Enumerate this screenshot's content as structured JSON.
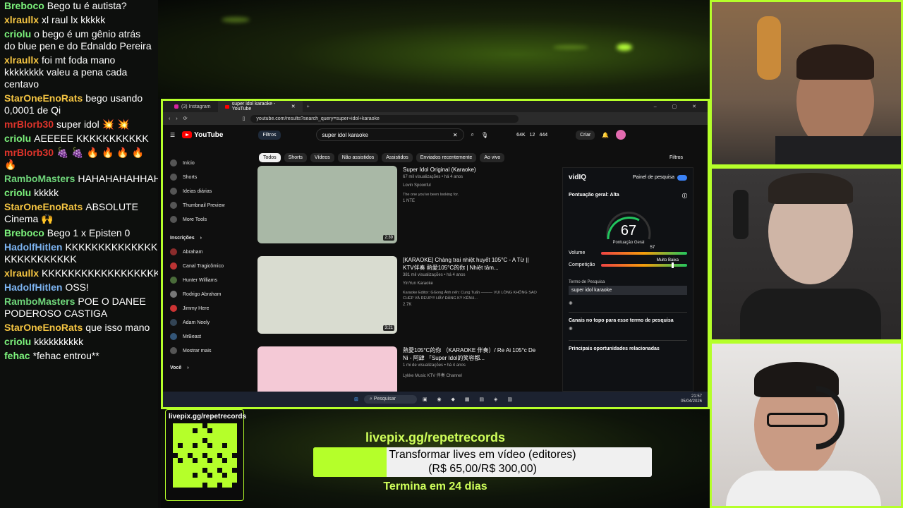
{
  "chat": {
    "messages": [
      {
        "user": "Breboco",
        "color": "#7cf27c",
        "text": "Bego tu é autista?"
      },
      {
        "user": "xlraullx",
        "color": "#f5c542",
        "text": "xl raul lx kkkkk"
      },
      {
        "user": "criolu",
        "color": "#7cf27c",
        "text": "o bego é um gênio atrás do blue pen e do Ednaldo Pereira"
      },
      {
        "user": "xlraullx",
        "color": "#f5c542",
        "text": "foi mt foda mano kkkkkkkk valeu a pena cada centavo"
      },
      {
        "user": "StarOneEnoRats",
        "color": "#f5c542",
        "text": "bego usando 0,0001 de Qi"
      },
      {
        "user": "mrBlorb30",
        "color": "#e0342b",
        "text": "super idol 💥 💥"
      },
      {
        "user": "criolu",
        "color": "#7cf27c",
        "text": "AEEEEE KKKKKKKKKKK"
      },
      {
        "user": "mrBlorb30",
        "color": "#e0342b",
        "text": "🍇 🍇 🔥 🔥 🔥 🔥 🔥"
      },
      {
        "user": "RamboMasters",
        "color": "#6fd67a",
        "text": "HAHAHAHAHHAHAHA"
      },
      {
        "user": "criolu",
        "color": "#7cf27c",
        "text": "kkkkk"
      },
      {
        "user": "StarOneEnoRats",
        "color": "#f5c542",
        "text": "ABSOLUTE Cinema 🙌"
      },
      {
        "user": "Breboco",
        "color": "#7cf27c",
        "text": "Bego 1 x Episten 0"
      },
      {
        "user": "HadolfHitlen",
        "color": "#7cb4f2",
        "text": "KKKKKKKKKKKKKKKKKKKK KKKKKKKKKKK"
      },
      {
        "user": "xlraullx",
        "color": "#f5c542",
        "text": "KKKKKKKKKKKKKKKKKKK"
      },
      {
        "user": "HadolfHitlen",
        "color": "#7cb4f2",
        "text": "OSS!"
      },
      {
        "user": "RamboMasters",
        "color": "#6fd67a",
        "text": "POE O DANEE PODEROSO CASTIGA"
      },
      {
        "user": "StarOneEnoRats",
        "color": "#f5c542",
        "text": "que isso mano"
      },
      {
        "user": "criolu",
        "color": "#7cf27c",
        "text": "kkkkkkkkkk"
      },
      {
        "user": "fehac",
        "color": "#7cf27c",
        "text": "*fehac entrou**"
      }
    ]
  },
  "browser": {
    "tabs": [
      "(3) Instagram",
      "super idol karaoke - YouTube"
    ],
    "url": "youtube.com/results?search_query=super+idol+karaoke",
    "yt_logo": "YouTube",
    "filters_label": "Filtros",
    "search_query": "super idol karaoke",
    "stats": [
      "64K",
      "12",
      "444"
    ],
    "create_label": "Criar",
    "chips": [
      "Todos",
      "Shorts",
      "Vídeos",
      "Não assistidos",
      "Assistidos",
      "Enviados recentemente",
      "Ao vivo"
    ],
    "filters_right": "Filtros",
    "sidebar": {
      "main": [
        "Início",
        "Shorts",
        "Ideias diárias",
        "Thumbnail Preview",
        "More Tools"
      ],
      "subs_header": "Inscrições",
      "subs": [
        "Abraham",
        "Canal Tragicômico",
        "Hunter Williams",
        "Rodrigo Abraham",
        "Jimmy Here",
        "Adam Neely",
        "MrBeast",
        "Mostrar mais"
      ],
      "you": "Você"
    },
    "results": [
      {
        "title": "Super Idol Original (Karaoke)",
        "meta": "67 mil visualizações • há 4 anos",
        "channel": "Lovin Spoonful",
        "desc": "The one you've been looking for.",
        "duration": "2:39",
        "badge": "1 NTE",
        "thumb_color": "#a9b8a6"
      },
      {
        "title": "[KARAOKE] Chàng trai nhiệt huyết 105°C - A Từ || KTV伴奏 熱愛105°C的你 | Nhiệt tâm...",
        "meta": "381 mil visualizações • há 4 anos",
        "channel": "YinYun Karaoke",
        "desc": "Karaoke Editor: GGong Ánh nến: Cung Tuấn ——— VUI LÒNG KHÔNG SAO CHÉP VÀ REUP!!! HÃY ĐĂNG KÝ KÊNH...",
        "duration": "3:21",
        "badge": "2.7K",
        "thumb_color": "#d9dcd0"
      },
      {
        "title": "熱愛105°C的你 （KARAOKE 伴奏）/ Re Ai 105°c De Ni - 阿肆 「Super Idol的笑容都...",
        "meta": "1 mi de visualizações • há 4 anos",
        "channel": "Lykke Music KTV 伴奏 Channel",
        "desc": "",
        "duration": "",
        "badge": "",
        "thumb_color": "#f4c9d6"
      }
    ],
    "vidiq": {
      "brand": "vidIQ",
      "panel_label": "Painel de pesquisa",
      "score_label": "Pontuação geral: Alta",
      "score": "67",
      "score_sub": "Pontuação Geral",
      "volume_label": "Volume",
      "volume_value": "57",
      "volume_level": 0.57,
      "competition_label": "Competição",
      "competition_value": "Muito Baixa",
      "competition_level": 0.82,
      "term_label": "Termo de Pesquisa",
      "term": "super idol karaoke",
      "channels_label": "Canais no topo para esse termo de pesquisa",
      "opps_label": "Principais oportunidades relacionadas"
    },
    "taskbar": {
      "search": "Pesquisar",
      "time": "21:57",
      "date": "05/04/2026"
    }
  },
  "banner": {
    "qr_label": "livepix.gg/repetrecords",
    "goal_url": "livepix.gg/repetrecords",
    "goal_line1": "Transformar lives em vídeo (editores)",
    "goal_line2": "(R$ 65,00/R$ 300,00)",
    "goal_progress": 0.217,
    "goal_end": "Termina em 24 dias"
  },
  "colors": {
    "accent": "#b5ff2a",
    "yt_red": "#ff0000"
  }
}
